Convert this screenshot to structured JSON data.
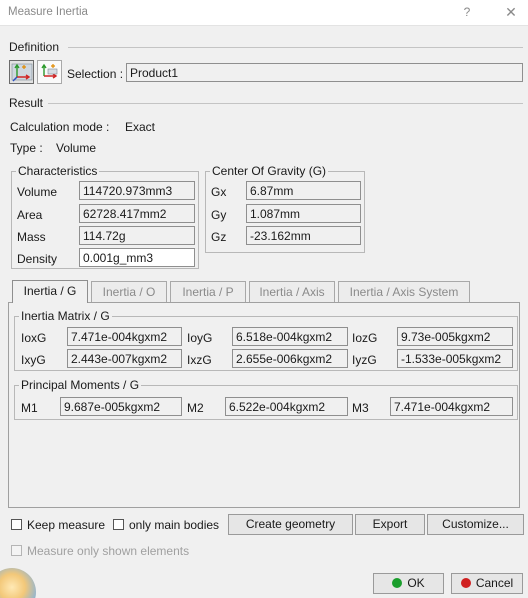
{
  "window": {
    "title": "Measure Inertia",
    "help": "?",
    "close": "✕"
  },
  "definition": {
    "label": "Definition",
    "selection_label": "Selection :",
    "selection_value": "Product1"
  },
  "result": {
    "label": "Result",
    "calc_mode_label": "Calculation mode :",
    "calc_mode_value": "Exact",
    "type_label": "Type :",
    "type_value": "Volume"
  },
  "characteristics": {
    "title": "Characteristics",
    "rows": [
      {
        "label": "Volume",
        "value": "114720.973mm3"
      },
      {
        "label": "Area",
        "value": "62728.417mm2"
      },
      {
        "label": "Mass",
        "value": "114.72g"
      },
      {
        "label": "Density",
        "value": "0.001g_mm3"
      }
    ]
  },
  "cog": {
    "title": "Center Of Gravity (G)",
    "rows": [
      {
        "label": "Gx",
        "value": "6.87mm"
      },
      {
        "label": "Gy",
        "value": "1.087mm"
      },
      {
        "label": "Gz",
        "value": "-23.162mm"
      }
    ]
  },
  "tabs": [
    {
      "label": "Inertia / G",
      "active": true
    },
    {
      "label": "Inertia / O",
      "active": false
    },
    {
      "label": "Inertia / P",
      "active": false
    },
    {
      "label": "Inertia / Axis",
      "active": false
    },
    {
      "label": "Inertia / Axis System",
      "active": false
    }
  ],
  "inertia_matrix": {
    "title": "Inertia Matrix / G",
    "cells": [
      {
        "label": "IoxG",
        "value": "7.471e-004kgxm2"
      },
      {
        "label": "IoyG",
        "value": "6.518e-004kgxm2"
      },
      {
        "label": "IozG",
        "value": "9.73e-005kgxm2"
      },
      {
        "label": "IxyG",
        "value": "2.443e-007kgxm2"
      },
      {
        "label": "IxzG",
        "value": "2.655e-006kgxm2"
      },
      {
        "label": "IyzG",
        "value": "-1.533e-005kgxm2"
      }
    ]
  },
  "principal": {
    "title": "Principal Moments / G",
    "cells": [
      {
        "label": "M1",
        "value": "9.687e-005kgxm2"
      },
      {
        "label": "M2",
        "value": "6.522e-004kgxm2"
      },
      {
        "label": "M3",
        "value": "7.471e-004kgxm2"
      }
    ]
  },
  "options": {
    "keep_measure": "Keep measure",
    "only_main_bodies": "only main bodies",
    "measure_only_shown": "Measure only shown elements"
  },
  "buttons": {
    "create_geometry": "Create geometry",
    "export": "Export",
    "customize": "Customize...",
    "ok": "OK",
    "cancel": "Cancel"
  },
  "colors": {
    "ok_dot": "#1a9e2c",
    "cancel_dot": "#d02020"
  },
  "icons": [
    "inertia-3d-icon",
    "inertia-2d-icon",
    "ok-icon",
    "cancel-icon",
    "close-icon",
    "help-icon"
  ]
}
